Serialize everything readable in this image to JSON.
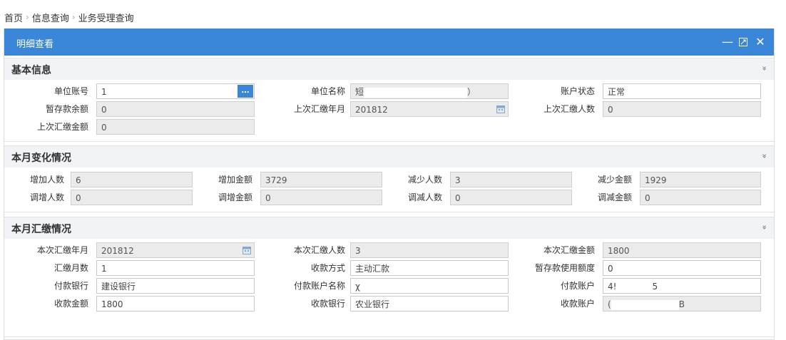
{
  "breadcrumb": {
    "home": "首页",
    "level1": "信息查询",
    "level2": "业务受理查询",
    "sep": "›"
  },
  "window": {
    "title": "明细查看",
    "minimize": "—",
    "maximize": "⤢",
    "close": "✕"
  },
  "sections": {
    "basic": {
      "title": "基本信息",
      "collapse": "»"
    },
    "change": {
      "title": "本月变化情况",
      "collapse": "»"
    },
    "payment": {
      "title": "本月汇缴情况",
      "collapse": "»"
    }
  },
  "basic": {
    "unit_account_label": "单位账号",
    "unit_account_value": "1",
    "unit_account_btn": "…",
    "unit_name_label": "单位名称",
    "unit_name_prefix": "短",
    "unit_name_suffix": "）",
    "account_status_label": "账户状态",
    "account_status_value": "正常",
    "temp_balance_label": "暂存款余额",
    "temp_balance_value": "0",
    "last_pay_month_label": "上次汇缴年月",
    "last_pay_month_value": "201812",
    "last_pay_count_label": "上次汇缴人数",
    "last_pay_count_value": "0",
    "last_pay_amount_label": "上次汇缴金额",
    "last_pay_amount_value": "0"
  },
  "change": {
    "add_count_label": "增加人数",
    "add_count_value": "6",
    "add_amount_label": "增加金额",
    "add_amount_value": "3729",
    "reduce_count_label": "减少人数",
    "reduce_count_value": "3",
    "reduce_amount_label": "减少金额",
    "reduce_amount_value": "1929",
    "adj_add_count_label": "调增人数",
    "adj_add_count_value": "0",
    "adj_add_amount_label": "调增金额",
    "adj_add_amount_value": "0",
    "adj_reduce_count_label": "调减人数",
    "adj_reduce_count_value": "0",
    "adj_reduce_amount_label": "调减金额",
    "adj_reduce_amount_value": "0"
  },
  "payment": {
    "pay_month_label": "本次汇缴年月",
    "pay_month_value": "201812",
    "pay_count_label": "本次汇缴人数",
    "pay_count_value": "3",
    "pay_amount_label": "本次汇缴金额",
    "pay_amount_value": "1800",
    "pay_months_label": "汇缴月数",
    "pay_months_value": "1",
    "pay_method_label": "收款方式",
    "pay_method_value": "主动汇款",
    "temp_use_label": "暂存款使用额度",
    "temp_use_value": "0",
    "payer_bank_label": "付款银行",
    "payer_bank_value": "建设银行",
    "payer_name_label": "付款账户名称",
    "payer_name_prefix": "χ",
    "payer_account_label": "付款账户",
    "payer_account_prefix": "4!",
    "payer_account_suffix": "5",
    "receive_amount_label": "收款金额",
    "receive_amount_value": "1800",
    "receive_bank_label": "收款银行",
    "receive_bank_value": "农业银行",
    "receive_account_label": "收款账户",
    "receive_account_prefix": "(",
    "receive_account_suffix": "B"
  },
  "colors": {
    "accent": "#3a86d8",
    "section_bg": "#f1f3f6",
    "readonly_bg": "#ebebeb"
  }
}
